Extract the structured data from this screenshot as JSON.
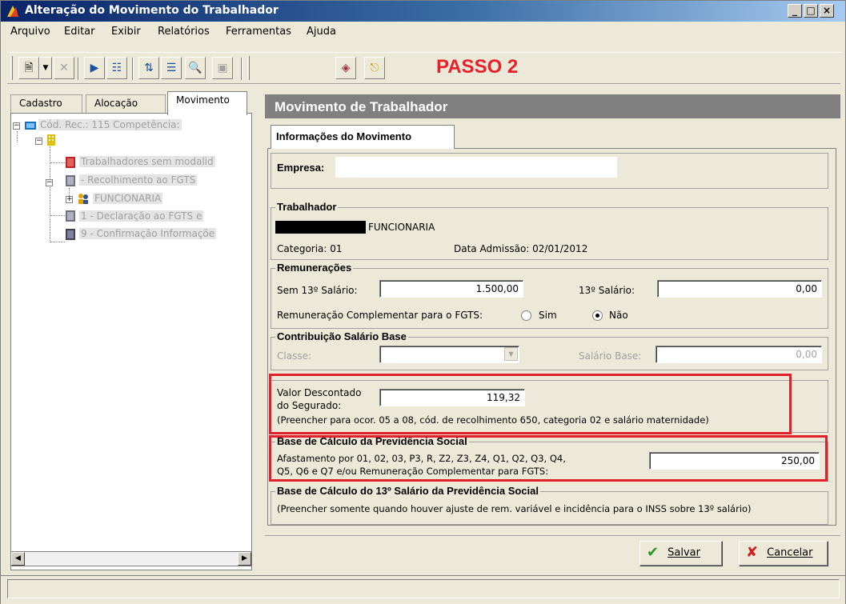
{
  "window": {
    "title": "Alteração do Movimento do Trabalhador",
    "controls": {
      "minimize": "_",
      "maximize": "□",
      "close": "×"
    }
  },
  "menu": [
    "Arquivo",
    "Editar",
    "Exibir",
    "Relatórios",
    "Ferramentas",
    "Ajuda"
  ],
  "annotation": {
    "text": "PASSO 2",
    "color": "#e8202a"
  },
  "left_tabs": [
    "Cadastro",
    "Alocação",
    "Movimento"
  ],
  "tree": {
    "root": "Cód. Rec.: 115 Competência:",
    "node_1": "Trabalhadores sem modalid",
    "node_2": " - Recolhimento ao FGTS",
    "node_3": "FUNCIONARIA",
    "node_4": "1 - Declaração ao FGTS e",
    "node_5": "9 - Confirmação Informaçõe"
  },
  "panel": {
    "header": "Movimento de Trabalhador",
    "tab": "Informações do Movimento",
    "empresa_label": "Empresa:",
    "empresa_value": "",
    "trabalhador": {
      "title": "Trabalhador",
      "name": "FUNCIONARIA",
      "categoria": "Categoria: 01",
      "admissao": "Data Admissão: 02/01/2012"
    },
    "remuneracoes": {
      "title": "Remunerações",
      "sem13_label": "Sem 13º Salário:",
      "sem13_value": "1.500,00",
      "sal13_label": "13º Salário:",
      "sal13_value": "0,00",
      "complementar_label": "Remuneração Complementar para o FGTS:",
      "sim": "Sim",
      "nao": "Não"
    },
    "contribuicao": {
      "title": "Contribuição Salário Base",
      "classe_label": "Classe:",
      "salario_base_label": "Salário Base:",
      "salario_base_value": "0,00"
    },
    "valor_descontado": {
      "label_1": "Valor Descontado",
      "label_2": "do Segurado:",
      "value": "119,32",
      "note": "(Preencher para ocor. 05 a 08, cód. de recolhimento 650, categoria 02 e salário maternidade)"
    },
    "base_previdencia": {
      "title": "Base de Cálculo da Previdência Social",
      "line_1": "Afastamento por 01, 02, 03, P3, R, Z2, Z3, Z4, Q1, Q2, Q3, Q4,",
      "line_2": "Q5, Q6 e Q7  e/ou Remuneração Complementar para FGTS:",
      "value": "250,00"
    },
    "base_13": {
      "title": "Base de Cálculo do 13º Salário da Previdência Social",
      "note": "(Preencher somente quando houver ajuste de rem. variável e incidência para o INSS sobre 13º salário)"
    },
    "buttons": {
      "save": "Salvar",
      "cancel": "Cancelar"
    }
  },
  "colors": {
    "highlight": "#e0202a",
    "header_bg": "#808080",
    "titlebar": "#0a246a"
  }
}
